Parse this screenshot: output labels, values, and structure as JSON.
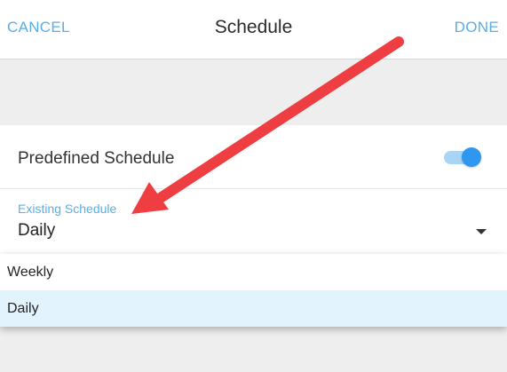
{
  "header": {
    "cancel_label": "CANCEL",
    "title": "Schedule",
    "done_label": "DONE"
  },
  "settings": {
    "predefined_label": "Predefined Schedule",
    "predefined_enabled": true,
    "existing_label": "Existing Schedule",
    "existing_value": "Daily"
  },
  "dropdown": {
    "options": [
      {
        "label": "Weekly",
        "selected": false
      },
      {
        "label": "Daily",
        "selected": true
      }
    ]
  },
  "colors": {
    "accent": "#5aaee6",
    "toggle_on": "#2e97ef",
    "selected_option_bg": "#e3f3fd",
    "annotation_arrow": "#ef3e42"
  },
  "icons": {
    "toggle": "toggle-switch",
    "caret": "caret-down-icon",
    "annotation": "red-arrow-annotation"
  }
}
